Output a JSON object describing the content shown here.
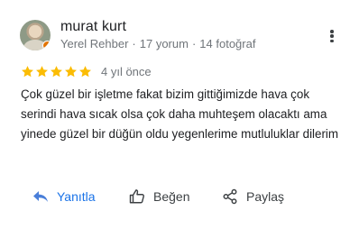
{
  "review": {
    "author": "murat kurt",
    "local_guide": "Yerel Rehber",
    "reviews_count": "17 yorum",
    "photos_count": "14 fotoğraf",
    "separator": "·",
    "rating": 5,
    "max_rating": 5,
    "date": "4 yıl önce",
    "text": "Çok güzel bir işletme fakat bizim gittiğimizde hava çok serindi hava sıcak olsa çok daha muhteşem olacaktı ama yinede güzel bir düğün oldu yegenlerime mutluluklar dilerim"
  },
  "actions": {
    "reply_label": "Yanıtla",
    "like_label": "Beğen",
    "share_label": "Paylaş"
  },
  "icons": {
    "more": "more-vertical-icon",
    "reply": "reply-arrow-icon",
    "like": "thumbs-up-icon",
    "share": "share-icon",
    "star": "star-icon"
  },
  "colors": {
    "star": "#fbbc04",
    "accent": "#1a73e8",
    "secondary_text": "#70757a",
    "badge": "#e37400"
  }
}
